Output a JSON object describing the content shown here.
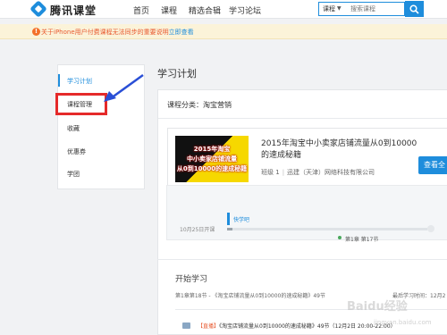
{
  "header": {
    "logo_text": "腾讯课堂",
    "nav": [
      "首页",
      "课程",
      "精选合辑",
      "学习论坛"
    ],
    "search": {
      "category": "课程",
      "placeholder": "搜索课程"
    }
  },
  "notice": {
    "text": "关于iPhone用户付费课程无法同步的重要说明",
    "link": "立即查看"
  },
  "sidebar": {
    "items": [
      {
        "label": "学习计划",
        "active": true
      },
      {
        "label": "课程管理"
      },
      {
        "label": "收藏"
      },
      {
        "label": "优惠券"
      },
      {
        "label": "学团"
      }
    ]
  },
  "main": {
    "page_title": "学习计划",
    "category_label": "课程分类：淘宝营销",
    "course": {
      "thumb_lines": [
        "2015年淘宝",
        "中小卖家店铺流量",
        "从0到10000的速成秘籍"
      ],
      "title": "2015年淘宝中小卖家店铺流量从0到10000的速成秘籍",
      "class_label": "班级 1",
      "institution": "迅建（天津）网络科技有限公司",
      "view_button": "查看全"
    },
    "progress": {
      "marker_label": "快学吧",
      "start_date": "10月25日开课",
      "current": "第1章 第17节"
    },
    "start_section": {
      "title": "开始学习",
      "last_lesson": "第1章第18节 - 《淘宝店铺流量从0到10000的速成秘籍》49节",
      "last_study_right": "最后学习时间：12月2",
      "live_tag": "【直播】",
      "live_text": "《淘宝店铺流量从0到10000的速成秘籍》49节（12月2日 20:00-22:00）"
    }
  },
  "watermark": {
    "text": "Baidu经验",
    "url": "jingyan.baidu.com"
  },
  "colors": {
    "accent": "#1e8ddc",
    "notice_bg": "#fbf3d9",
    "highlight": "#e52a2a"
  }
}
